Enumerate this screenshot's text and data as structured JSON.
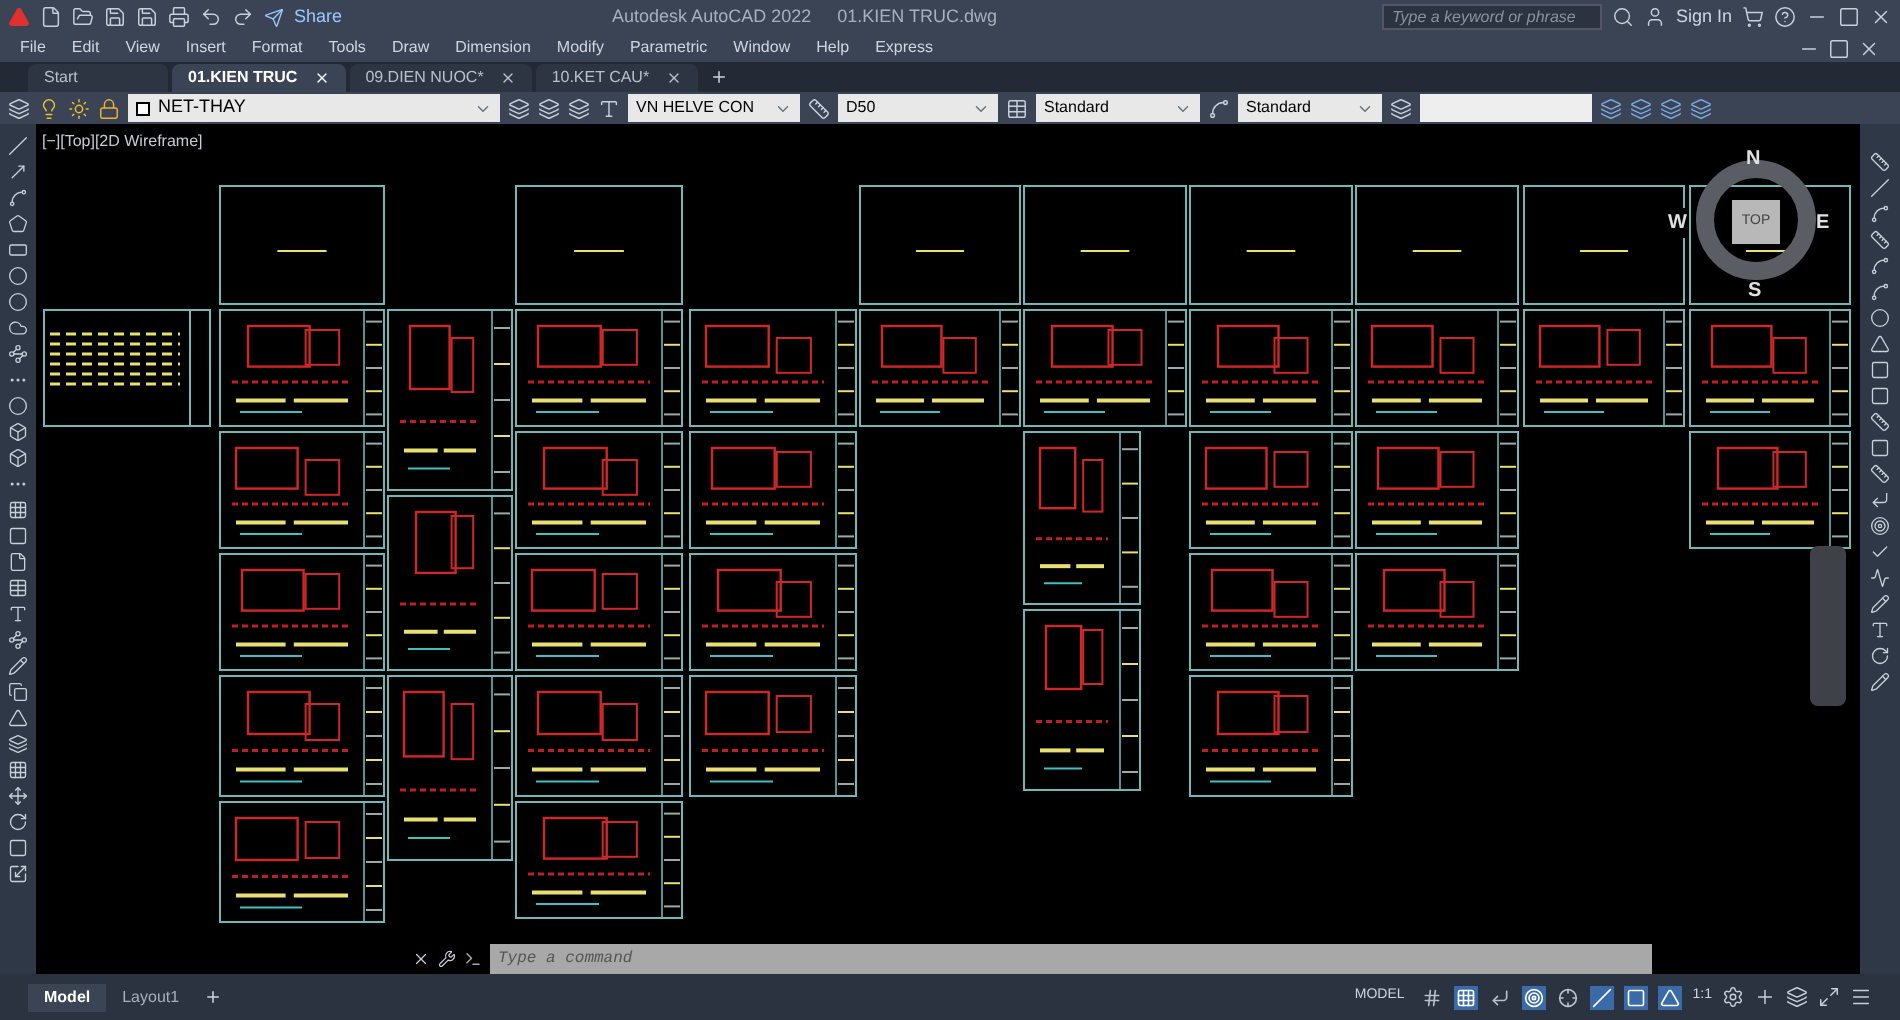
{
  "title_bar": {
    "share": "Share",
    "app_title": "Autodesk AutoCAD 2022",
    "file_name": "01.KIEN TRUC.dwg",
    "search": {
      "placeholder": "Type a keyword or phrase"
    },
    "sign_in": "Sign In"
  },
  "menu": [
    "File",
    "Edit",
    "View",
    "Insert",
    "Format",
    "Tools",
    "Draw",
    "Dimension",
    "Modify",
    "Parametric",
    "Window",
    "Help",
    "Express"
  ],
  "tabs": [
    {
      "label": "Start",
      "selected": false,
      "closable": false
    },
    {
      "label": "01.KIEN TRUC",
      "selected": true,
      "closable": true
    },
    {
      "label": "09.DIEN NUOC*",
      "selected": false,
      "closable": true
    },
    {
      "label": "10.KET CAU*",
      "selected": false,
      "closable": true
    }
  ],
  "toolbar": {
    "layer": "NET-THAY",
    "text_style": "VN HELVE CON",
    "dim_style": "D50",
    "table_style": "Standard",
    "multileader_style": "Standard"
  },
  "viewport": {
    "label": "[−][Top][2D Wireframe]",
    "view_cube": {
      "face": "TOP",
      "north": "N",
      "south": "S",
      "east": "E",
      "west": "W"
    }
  },
  "command_line": {
    "placeholder": "Type a command"
  },
  "layout_tabs": [
    {
      "label": "Model",
      "selected": true
    },
    {
      "label": "Layout1",
      "selected": false
    }
  ],
  "status_bar": {
    "space": "MODEL",
    "scale": "1:1",
    "toggles": [
      {
        "on": false
      },
      {
        "on": true
      },
      {
        "on": false
      },
      {
        "on": true
      },
      {
        "on": false
      },
      {
        "on": true
      },
      {
        "on": true
      },
      {
        "on": true
      }
    ]
  }
}
